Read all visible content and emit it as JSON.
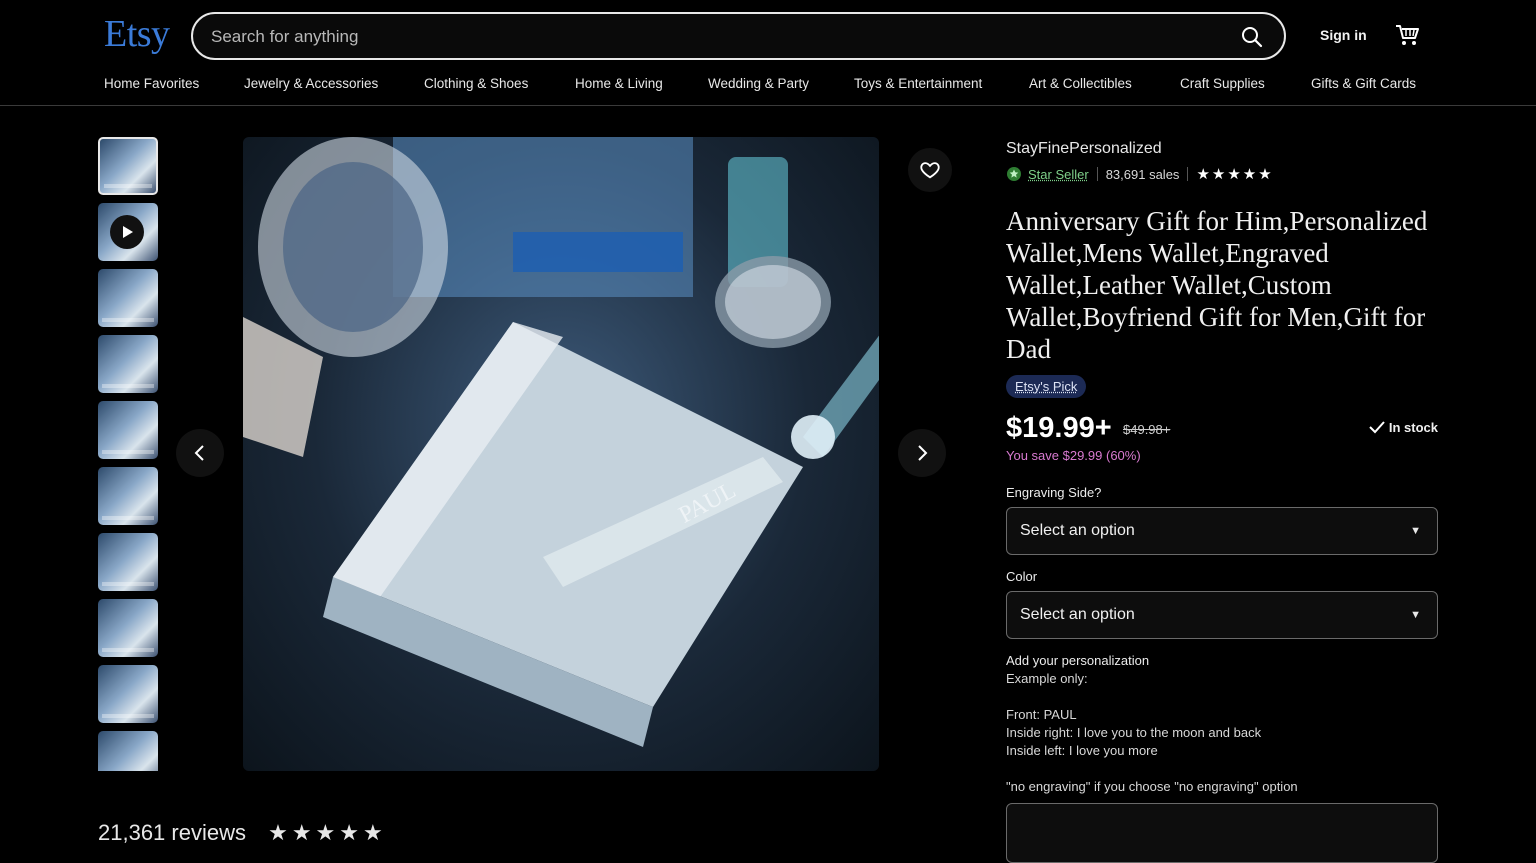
{
  "header": {
    "logo": "Etsy",
    "search_placeholder": "Search for anything",
    "sign_in": "Sign in"
  },
  "nav": [
    "Home Favorites",
    "Jewelry & Accessories",
    "Clothing & Shoes",
    "Home & Living",
    "Wedding & Party",
    "Toys & Entertainment",
    "Art & Collectibles",
    "Craft Supplies",
    "Gifts & Gift Cards"
  ],
  "gallery": {
    "thumbnail_count": 10,
    "engraving_text": "PAUL"
  },
  "listing": {
    "shop_name": "StayFinePersonalized",
    "star_seller": "Star Seller",
    "sales": "83,691 sales",
    "rating_stars": "★★★★★",
    "title": "Anniversary Gift for Him,Personalized Wallet,Mens Wallet,Engraved Wallet,Leather Wallet,Custom Wallet,Boyfriend Gift for Men,Gift for Dad",
    "badge": "Etsy's Pick",
    "price": "$19.99+",
    "original_price": "$49.98+",
    "stock": "In stock",
    "savings": "You save $29.99 (60%)"
  },
  "options": {
    "engraving_label": "Engraving Side?",
    "engraving_value": "Select an option",
    "color_label": "Color",
    "color_value": "Select an option"
  },
  "personalization": {
    "heading": "Add your personalization",
    "line1": "Example only:",
    "line2": "Front: PAUL",
    "line3": "Inside right: I love you to the moon and back",
    "line4": "Inside left: I love you more",
    "line5": "\"no engraving\" if you choose \"no engraving\" option"
  },
  "reviews": {
    "count_text": "21,361 reviews",
    "stars": "★★★★★"
  },
  "colors": {
    "brand": "#3b7bd8",
    "star_seller": "#7fd08a",
    "savings": "#d87ad0",
    "badge_bg": "#1c2a55"
  }
}
